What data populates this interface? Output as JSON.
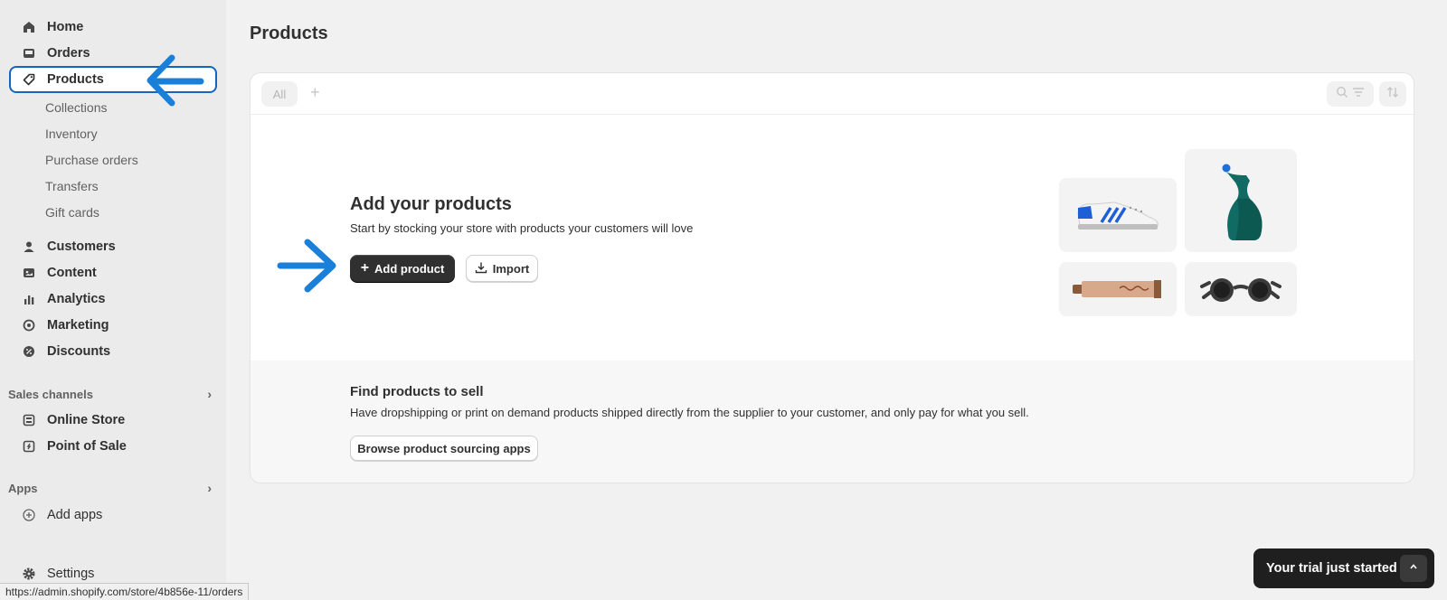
{
  "sidebar": {
    "items": [
      {
        "label": "Home",
        "icon": "home-icon"
      },
      {
        "label": "Orders",
        "icon": "inbox-icon"
      },
      {
        "label": "Products",
        "icon": "tag-icon",
        "active": true
      }
    ],
    "product_subitems": [
      "Collections",
      "Inventory",
      "Purchase orders",
      "Transfers",
      "Gift cards"
    ],
    "items2": [
      {
        "label": "Customers",
        "icon": "person-icon"
      },
      {
        "label": "Content",
        "icon": "content-icon"
      },
      {
        "label": "Analytics",
        "icon": "bar-chart-icon"
      },
      {
        "label": "Marketing",
        "icon": "target-icon"
      },
      {
        "label": "Discounts",
        "icon": "discount-icon"
      }
    ],
    "sales_channels": {
      "heading": "Sales channels",
      "items": [
        {
          "label": "Online Store",
          "icon": "store-icon"
        },
        {
          "label": "Point of Sale",
          "icon": "pos-icon"
        }
      ]
    },
    "apps": {
      "heading": "Apps",
      "add_label": "Add apps"
    },
    "settings_label": "Settings"
  },
  "main": {
    "title": "Products",
    "tabs": {
      "all": "All"
    },
    "empty_state": {
      "title": "Add your products",
      "subtitle": "Start by stocking your store with products your customers will love",
      "add_button": "Add product",
      "import_button": "Import"
    },
    "find_section": {
      "title": "Find products to sell",
      "subtitle": "Have dropshipping or print on demand products shipped directly from the supplier to your customer, and only pay for what you sell.",
      "button": "Browse product sourcing apps"
    }
  },
  "toast": {
    "label": "Your trial just started"
  },
  "status_bar": {
    "url": "https://admin.shopify.com/store/4b856e-11/orders"
  },
  "colors": {
    "annotation_blue": "#1a7fd8",
    "primary_button": "#303030",
    "active_border": "#1565c0"
  }
}
